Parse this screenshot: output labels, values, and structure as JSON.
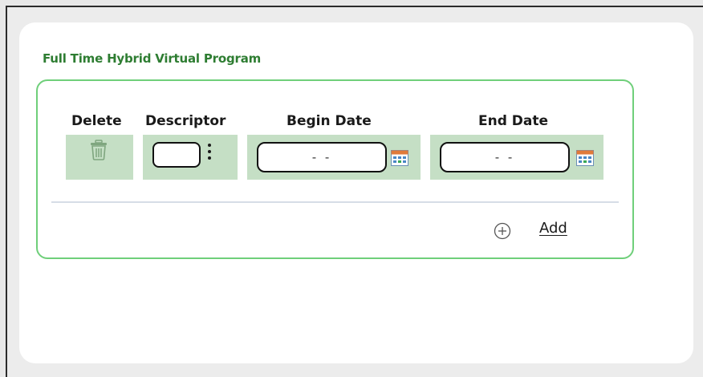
{
  "section": {
    "title": "Full Time Hybrid Virtual Program"
  },
  "columns": {
    "delete": "Delete",
    "descriptor": "Descriptor",
    "begin_date": "Begin Date",
    "end_date": "End Date"
  },
  "row": {
    "descriptor_value": "",
    "begin_date_value": "- -",
    "end_date_value": "- -"
  },
  "actions": {
    "add_label": "Add"
  },
  "icons": {
    "delete": "trash-icon",
    "descriptor_menu": "kebab-menu-icon",
    "calendar": "calendar-icon",
    "add": "plus-circle-icon"
  },
  "colors": {
    "accent_green": "#2e7d32",
    "border_green": "#6fcf7a",
    "cell_green": "#c5dfc5"
  }
}
